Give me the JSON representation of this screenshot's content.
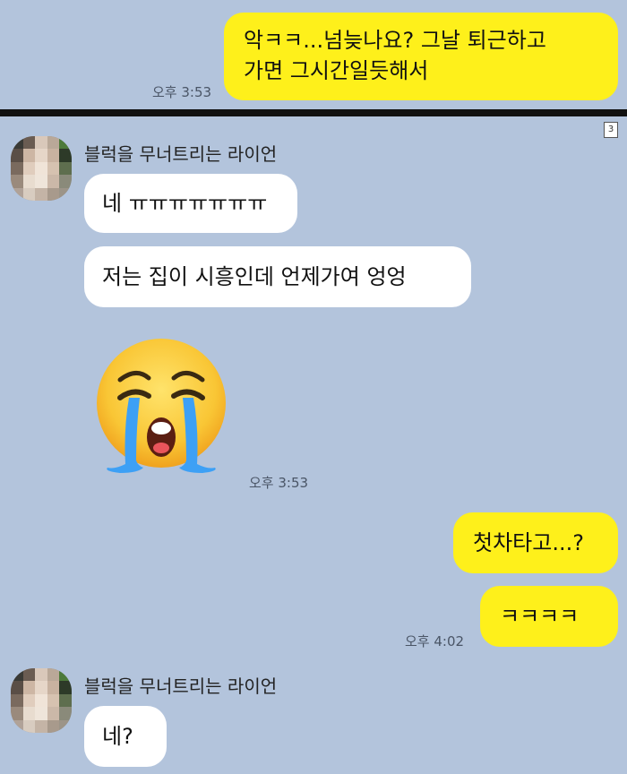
{
  "top": {
    "me_message": [
      "악ㅋㅋ...넘늦나요? 그날 퇴근하고",
      "가면 그시간일듯해서"
    ],
    "time": "오후 3:53"
  },
  "page_badge": "3",
  "thread": {
    "sender_name": "블럭을 무너트리는 라이언",
    "their_messages_1": [
      "네 ㅠㅠㅠㅠㅠㅠㅠ",
      "저는 집이 시흥인데 언제가여 엉엉"
    ],
    "emoji": "loudly-crying-face",
    "time_1": "오후 3:53",
    "my_messages": [
      "첫차타고...?",
      "ㅋㅋㅋㅋ"
    ],
    "time_2": "오후 4:02",
    "their_messages_2": [
      "네?"
    ]
  },
  "colors": {
    "background": "#b3c4dc",
    "my_bubble": "#fef01b",
    "their_bubble": "#ffffff"
  }
}
